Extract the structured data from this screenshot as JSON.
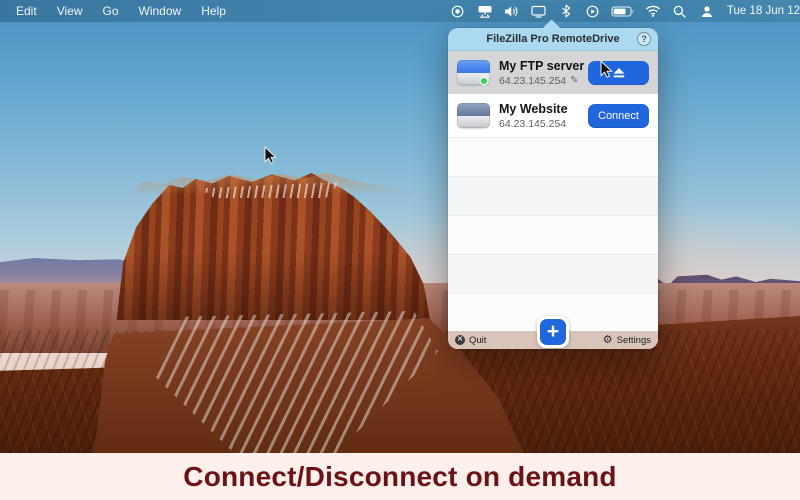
{
  "menu_bar": {
    "items": [
      "Edit",
      "View",
      "Go",
      "Window",
      "Help"
    ],
    "clock": "Tue 18 Jun 12",
    "status_icons": {
      "record": "dot-in-circle",
      "remotedrive": "drive-with-stand",
      "volume": "speaker-with-waves",
      "display": "monitor",
      "bluetooth": "bluetooth-rune",
      "screen_record": "play-in-circle",
      "battery": "battery-three-quarters",
      "wifi": "wifi-arcs",
      "search": "magnifier",
      "user": "fast-user-switching"
    }
  },
  "popover": {
    "title": "FileZilla Pro RemoteDrive",
    "help_label": "?",
    "servers": [
      {
        "name": "My FTP server",
        "ip": "64.23.145.254",
        "status": "connected",
        "action_icon": "eject",
        "edit_icon": "pencil"
      },
      {
        "name": "My Website",
        "ip": "64.23.145.254",
        "status": "disconnected",
        "action": "Connect"
      }
    ],
    "footer": {
      "quit": "Quit",
      "settings": "Settings",
      "add": "+"
    }
  },
  "banner": {
    "text": "Connect/Disconnect on demand"
  },
  "colors": {
    "accent_blue": "#2066dd",
    "popover_header_blue": "#abd9ef",
    "connected_green": "#2fd158",
    "row_highlight": "#d5d5d7",
    "footer_tan": "#d7c0b6",
    "banner_bg": "#fdefec",
    "banner_text": "#6c1116",
    "menubar_blue": "#3f81aa"
  }
}
